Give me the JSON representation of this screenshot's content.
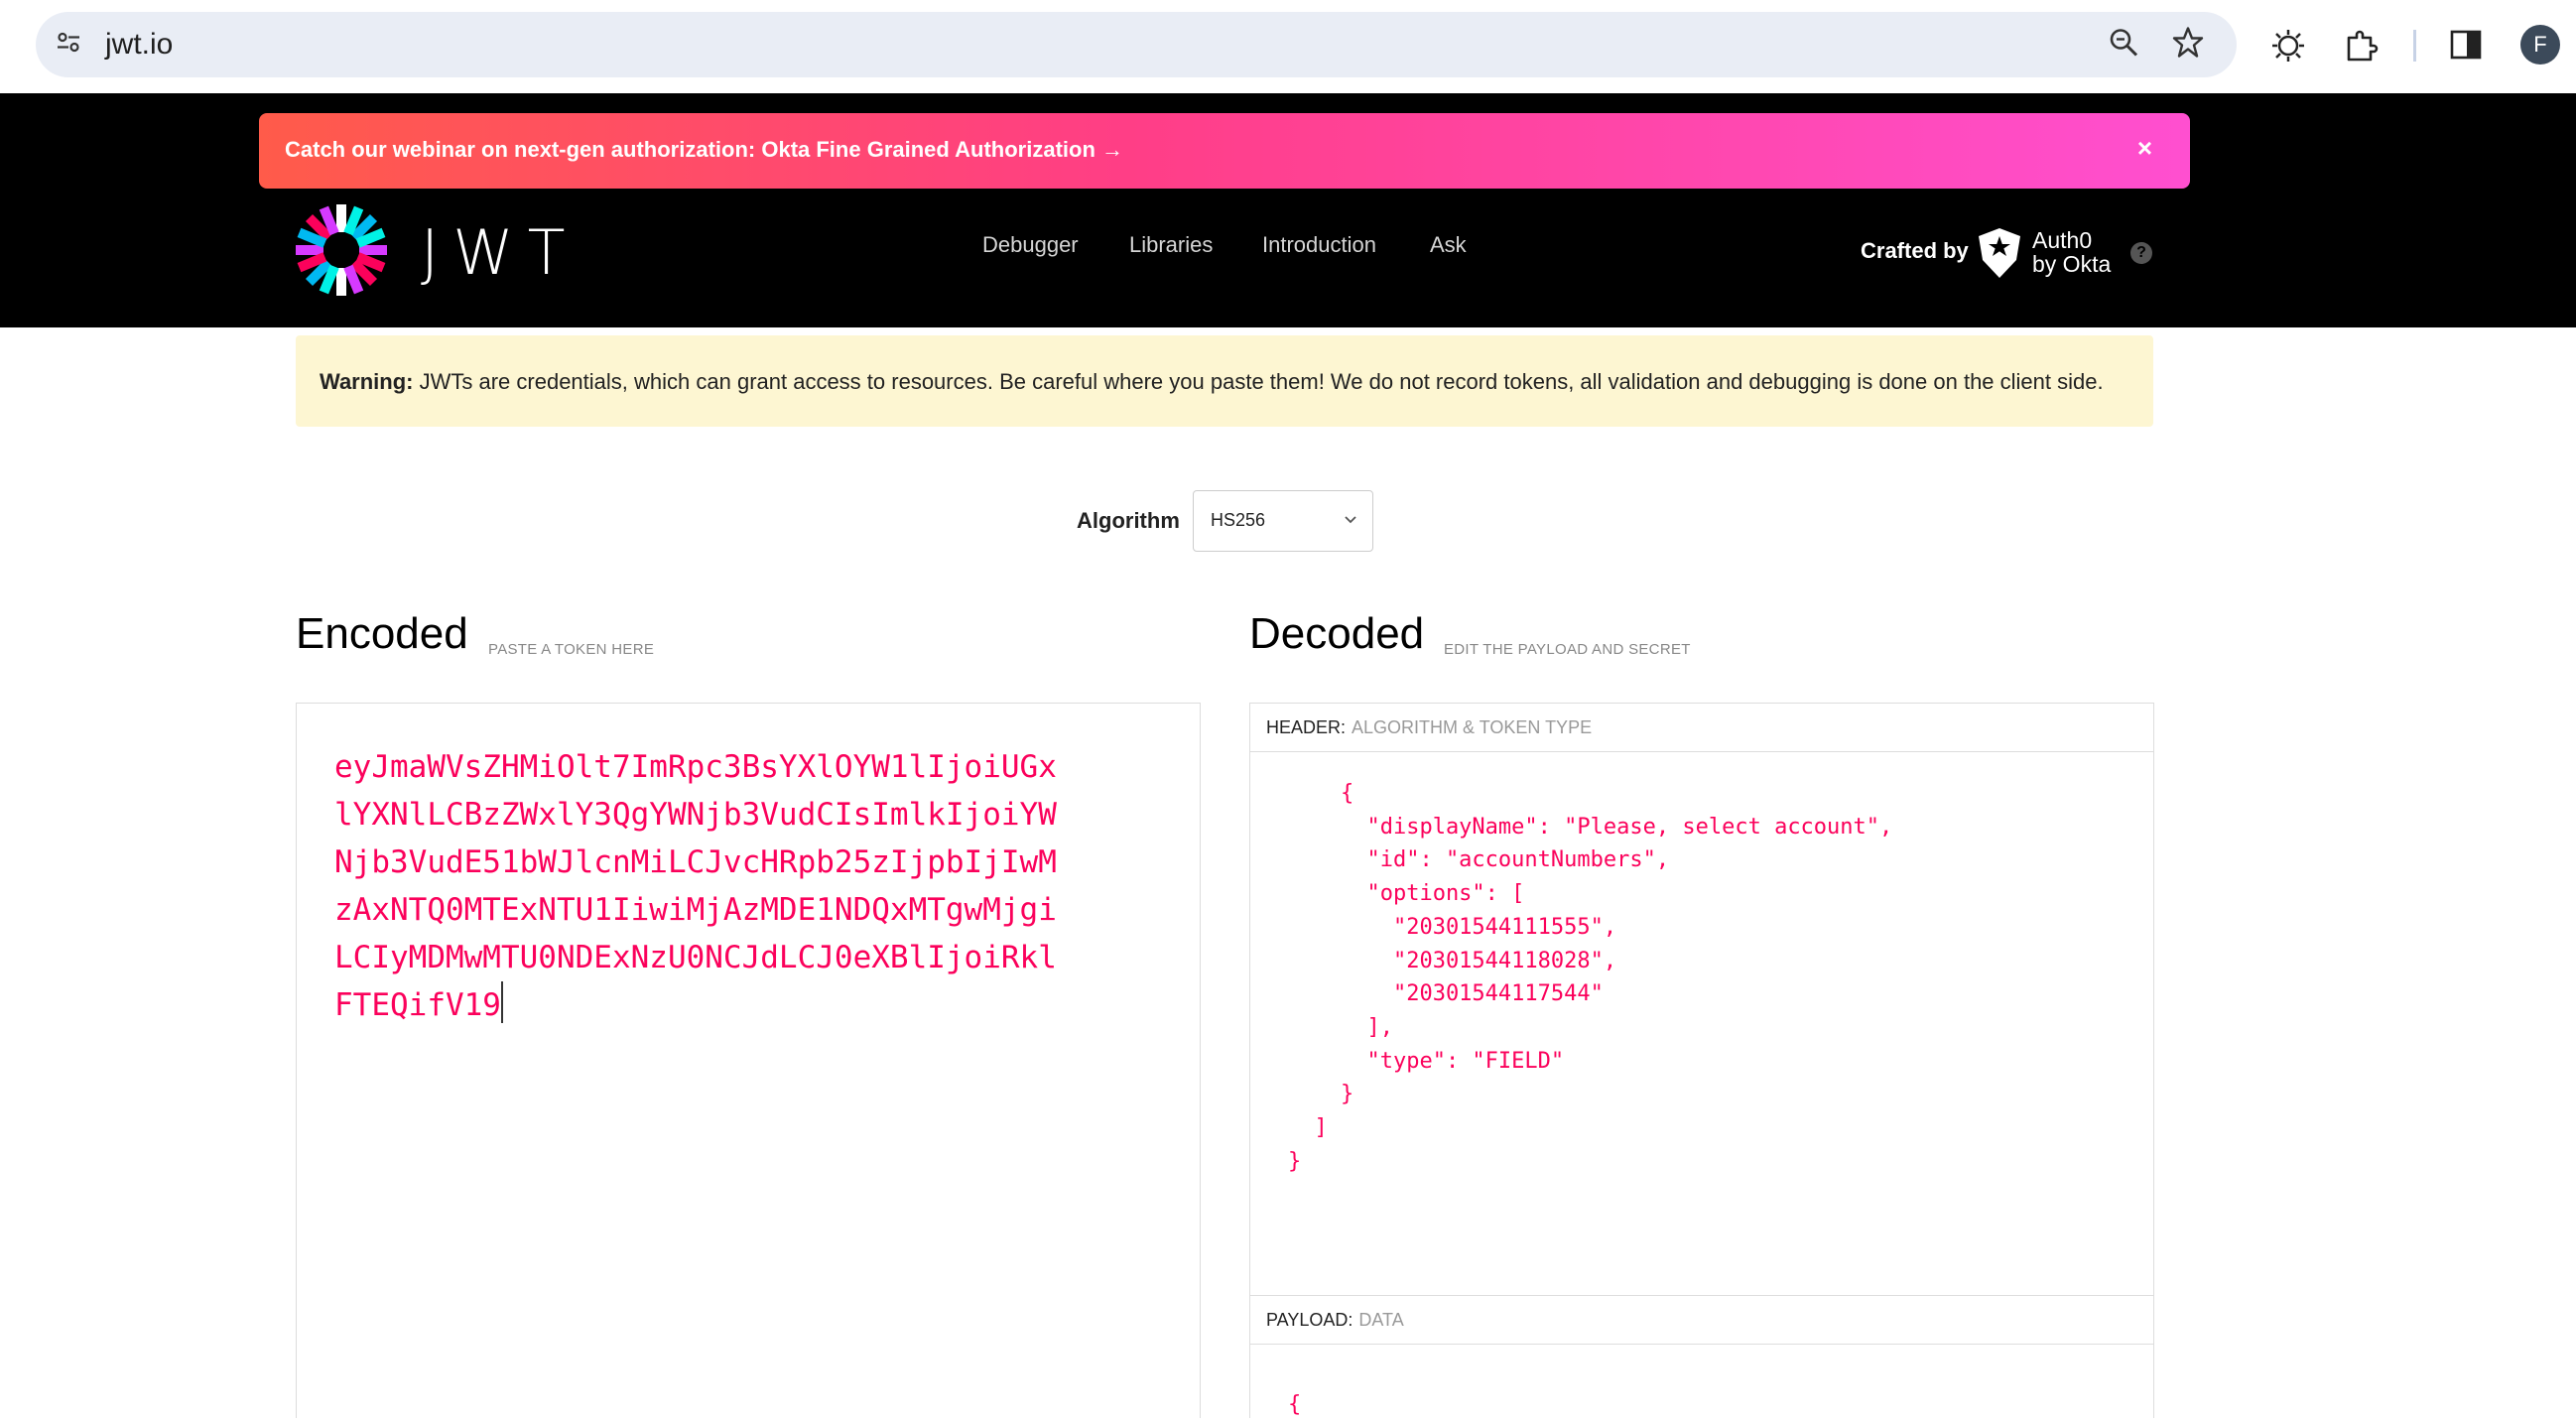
{
  "browser": {
    "url": "jwt.io",
    "profile_initial": "F"
  },
  "banner": {
    "text": "Catch our webinar on next-gen authorization: Okta Fine Grained Authorization →",
    "close": "×"
  },
  "brand": {
    "logo_text": "JWT"
  },
  "nav": {
    "items": [
      {
        "label": "Debugger"
      },
      {
        "label": "Libraries"
      },
      {
        "label": "Introduction"
      },
      {
        "label": "Ask"
      }
    ]
  },
  "crafted": {
    "label": "Crafted by",
    "auth0_line1": "Auth0",
    "auth0_line2": "by Okta",
    "help": "?"
  },
  "warning": {
    "bold": "Warning:",
    "text": " JWTs are credentials, which can grant access to resources. Be careful where you paste them! We do not record tokens, all validation and debugging is done on the client side."
  },
  "algorithm": {
    "label": "Algorithm",
    "value": "HS256"
  },
  "encoded": {
    "title": "Encoded",
    "subtitle": "PASTE A TOKEN HERE",
    "token_lines": [
      "eyJmaWVsZHMiOlt7ImRpc3BsYXlOYW1lIjoiUGx",
      "lYXNlLCBzZWxlY3QgYWNjb3VudCIsImlkIjoiYW",
      "Njb3VudE51bWJlcnMiLCJvcHRpb25zIjpbIjIwM",
      "zAxNTQ0MTExNTU1IiwiMjAzMDE1NDQxMTgwMjgi",
      "LCIyMDMwMTU0NDExNzU0NCJdLCJ0eXBlIjoiRkl",
      "FTEQifV19"
    ]
  },
  "decoded": {
    "title": "Decoded",
    "subtitle": "EDIT THE PAYLOAD AND SECRET",
    "header_label": "HEADER:",
    "header_sub": "ALGORITHM & TOKEN TYPE",
    "payload_label": "PAYLOAD:",
    "payload_sub": "DATA",
    "header_json_lines": [
      "    {",
      "      \"displayName\": \"Please, select account\",",
      "      \"id\": \"accountNumbers\",",
      "      \"options\": [",
      "        \"20301544111555\",",
      "        \"20301544118028\",",
      "        \"20301544117544\"",
      "      ],",
      "      \"type\": \"FIELD\"",
      "    }",
      "  ]",
      "}"
    ],
    "payload_json_first": "{"
  }
}
